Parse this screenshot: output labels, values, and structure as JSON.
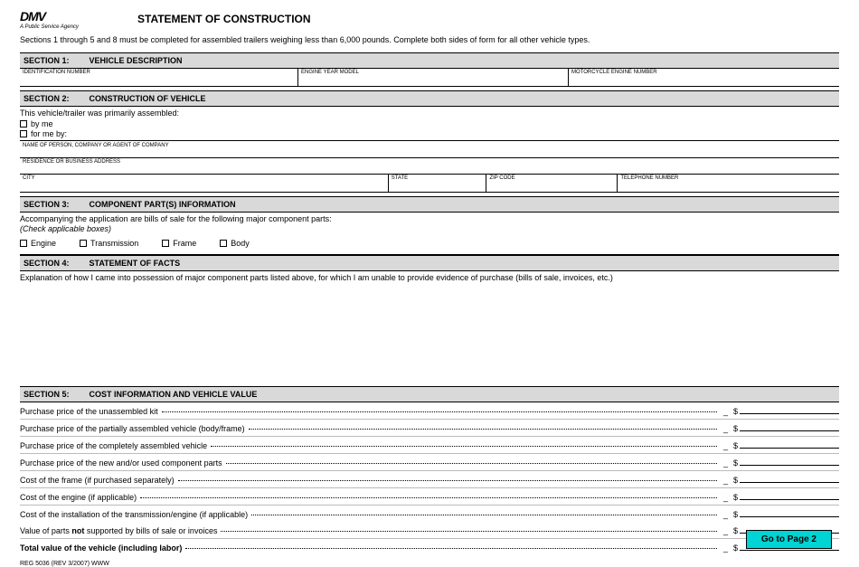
{
  "header": {
    "logo_main": "DMV",
    "logo_sub": "A Public Service Agency",
    "title": "STATEMENT OF CONSTRUCTION"
  },
  "intro": "Sections 1 through 5 and 8 must be completed for assembled trailers weighing less than 6,000 pounds. Complete both sides of form for all other vehicle types.",
  "section1": {
    "num": "SECTION 1:",
    "title": "VEHICLE DESCRIPTION",
    "fields": {
      "id": "IDENTIFICATION NUMBER",
      "eym": "ENGINE YEAR MODEL",
      "men": "MOTORCYCLE ENGINE NUMBER"
    }
  },
  "section2": {
    "num": "SECTION 2:",
    "title": "CONSTRUCTION OF VEHICLE",
    "lead": "This vehicle/trailer was primarily assembled:",
    "opt1": "by me",
    "opt2": "for me  by:",
    "name_label": "NAME OF PERSON, COMPANY OR AGENT OF COMPANY",
    "addr_label": "RESIDENCE OR BUSINESS ADDRESS",
    "city": "CITY",
    "state": "STATE",
    "zip": "ZIP CODE",
    "phone": "TELEPHONE NUMBER"
  },
  "section3": {
    "num": "SECTION 3:",
    "title": "COMPONENT PART(S) INFORMATION",
    "lead": "Accompanying the application are bills of sale for the following major component parts:",
    "sub": "(Check applicable boxes)",
    "opts": {
      "engine": "Engine",
      "trans": "Transmission",
      "frame": "Frame",
      "body": "Body"
    }
  },
  "section4": {
    "num": "SECTION 4:",
    "title": "STATEMENT OF FACTS",
    "text": "Explanation of how I came into possession of major component parts listed above, for which I am unable to provide evidence of purchase (bills of sale, invoices, etc.)"
  },
  "section5": {
    "num": "SECTION 5:",
    "title": "COST INFORMATION AND VEHICLE VALUE",
    "lines": [
      "Purchase price of the unassembled kit",
      "Purchase price of the partially assembled vehicle (body/frame)",
      "Purchase price of the completely assembled vehicle",
      "Purchase price of the new and/or used component parts",
      "Cost of the frame (if purchased separately)",
      "Cost of the engine (if applicable)",
      "Cost of the installation of the transmission/engine (if applicable)"
    ],
    "line_notbold": "Value of parts not supported by bills of sale or invoices",
    "line_not_pre": "Value of parts ",
    "line_not_bold": "not",
    "line_not_post": " supported by bills of sale or invoices",
    "line_total": "Total value of the vehicle (including labor)",
    "us": "_",
    "dollar": "$"
  },
  "footer": "REG 5036 (REV 3/2007) WWW",
  "goto": "Go to Page 2"
}
